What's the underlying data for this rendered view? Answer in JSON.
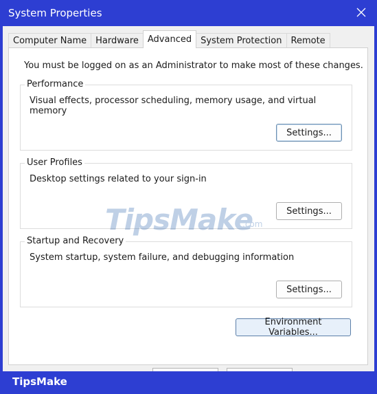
{
  "window": {
    "title": "System Properties"
  },
  "tabs": [
    {
      "label": "Computer Name",
      "active": false
    },
    {
      "label": "Hardware",
      "active": false
    },
    {
      "label": "Advanced",
      "active": true
    },
    {
      "label": "System Protection",
      "active": false
    },
    {
      "label": "Remote",
      "active": false
    }
  ],
  "notice": "You must be logged on as an Administrator to make most of these changes.",
  "groups": {
    "performance": {
      "title": "Performance",
      "description": "Visual effects, processor scheduling, memory usage, and virtual memory",
      "button": "Settings..."
    },
    "user_profiles": {
      "title": "User Profiles",
      "description": "Desktop settings related to your sign-in",
      "button": "Settings..."
    },
    "startup_recovery": {
      "title": "Startup and Recovery",
      "description": "System startup, system failure, and debugging information",
      "button": "Settings..."
    }
  },
  "env_button": "Environment Variables...",
  "watermark": {
    "main": "TipsMake",
    "suffix": ".com"
  },
  "branding": "TipsMake",
  "colors": {
    "titlebar": "#2d3ed2",
    "accent": "#5b7ea8"
  }
}
